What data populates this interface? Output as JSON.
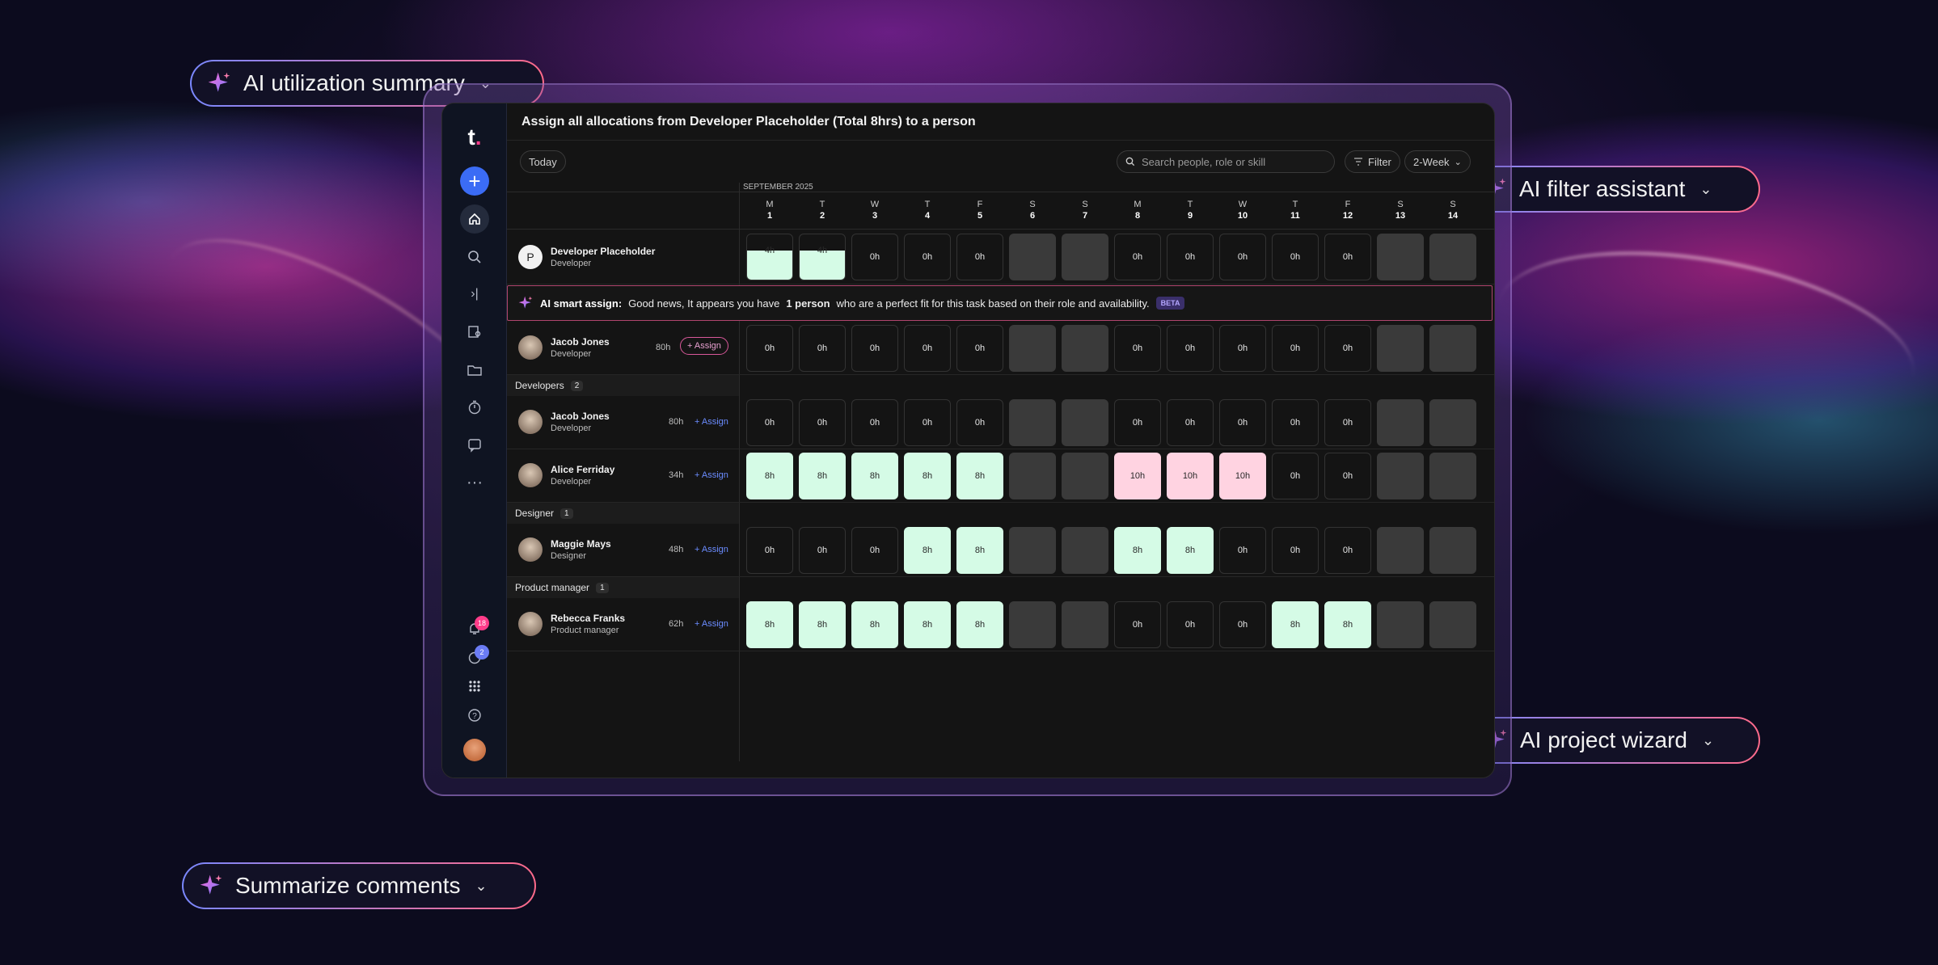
{
  "chips": {
    "utilization": "AI utilization summary",
    "filter": "AI filter assistant",
    "wizard": "AI project wizard",
    "comments": "Summarize comments"
  },
  "sidebar": {
    "logo": "t",
    "icons": [
      "plus-icon",
      "home-icon",
      "search-icon",
      "collapse-icon",
      "people-icon",
      "folder-icon",
      "timer-icon",
      "feedback-icon",
      "more-icon",
      "bell-icon",
      "chat-icon",
      "apps-icon",
      "help-icon"
    ],
    "notifications_badge": "18",
    "chat_badge": "2"
  },
  "header": {
    "title": "Assign all allocations from Developer Placeholder (Total 8hrs) to a person"
  },
  "toolbar": {
    "today": "Today",
    "search_placeholder": "Search people, role or skill",
    "filter": "Filter",
    "view": "2-Week"
  },
  "calendar": {
    "month": "SEPTEMBER 2025",
    "days": [
      {
        "d": "M",
        "n": "1"
      },
      {
        "d": "T",
        "n": "2"
      },
      {
        "d": "W",
        "n": "3"
      },
      {
        "d": "T",
        "n": "4"
      },
      {
        "d": "F",
        "n": "5"
      },
      {
        "d": "S",
        "n": "6"
      },
      {
        "d": "S",
        "n": "7"
      },
      {
        "d": "M",
        "n": "8"
      },
      {
        "d": "T",
        "n": "9"
      },
      {
        "d": "W",
        "n": "10"
      },
      {
        "d": "T",
        "n": "11"
      },
      {
        "d": "F",
        "n": "12"
      },
      {
        "d": "S",
        "n": "13"
      },
      {
        "d": "S",
        "n": "14"
      }
    ]
  },
  "placeholder": {
    "initial": "P",
    "name": "Developer Placeholder",
    "role": "Developer",
    "cells": [
      "4h",
      "4h",
      "0h",
      "0h",
      "0h",
      "",
      "",
      "0h",
      "0h",
      "0h",
      "0h",
      "0h",
      "",
      ""
    ]
  },
  "ai_assign": {
    "title": "AI smart assign:",
    "text_before": "Good news, It appears you have",
    "highlight": "1 person",
    "text_after": "who are a perfect fit for this task based on their role and availability.",
    "beta": "BETA"
  },
  "suggested": {
    "name": "Jacob Jones",
    "role": "Developer",
    "hours": "80h",
    "assign": "Assign",
    "cells": [
      "0h",
      "0h",
      "0h",
      "0h",
      "0h",
      "",
      "",
      "0h",
      "0h",
      "0h",
      "0h",
      "0h",
      "",
      ""
    ]
  },
  "groups": [
    {
      "label": "Developers",
      "count": "2",
      "people": [
        {
          "name": "Jacob Jones",
          "role": "Developer",
          "hours": "80h",
          "assign": "Assign",
          "cells": [
            "0h",
            "0h",
            "0h",
            "0h",
            "0h",
            "",
            "",
            "0h",
            "0h",
            "0h",
            "0h",
            "0h",
            "",
            ""
          ]
        },
        {
          "name": "Alice Ferriday",
          "role": "Developer",
          "hours": "34h",
          "assign": "Assign",
          "cells": [
            "8h",
            "8h",
            "8h",
            "8h",
            "8h",
            "",
            "",
            "10h",
            "10h",
            "10h",
            "0h",
            "0h",
            "",
            ""
          ]
        }
      ]
    },
    {
      "label": "Designer",
      "count": "1",
      "people": [
        {
          "name": "Maggie Mays",
          "role": "Designer",
          "hours": "48h",
          "assign": "Assign",
          "cells": [
            "0h",
            "0h",
            "0h",
            "8h",
            "8h",
            "",
            "",
            "8h",
            "8h",
            "0h",
            "0h",
            "0h",
            "",
            ""
          ]
        }
      ]
    },
    {
      "label": "Product manager",
      "count": "1",
      "people": [
        {
          "name": "Rebecca Franks",
          "role": "Product manager",
          "hours": "62h",
          "assign": "Assign",
          "cells": [
            "8h",
            "8h",
            "8h",
            "8h",
            "8h",
            "",
            "",
            "0h",
            "0h",
            "0h",
            "8h",
            "8h",
            "",
            ""
          ]
        }
      ]
    }
  ],
  "colors": {
    "allocated": "#d5fbe6",
    "overallocated": "#ffd3e1",
    "weekend": "#3a3a3a",
    "accent": "#3b6cf5",
    "ai_border": "#b0456e"
  }
}
